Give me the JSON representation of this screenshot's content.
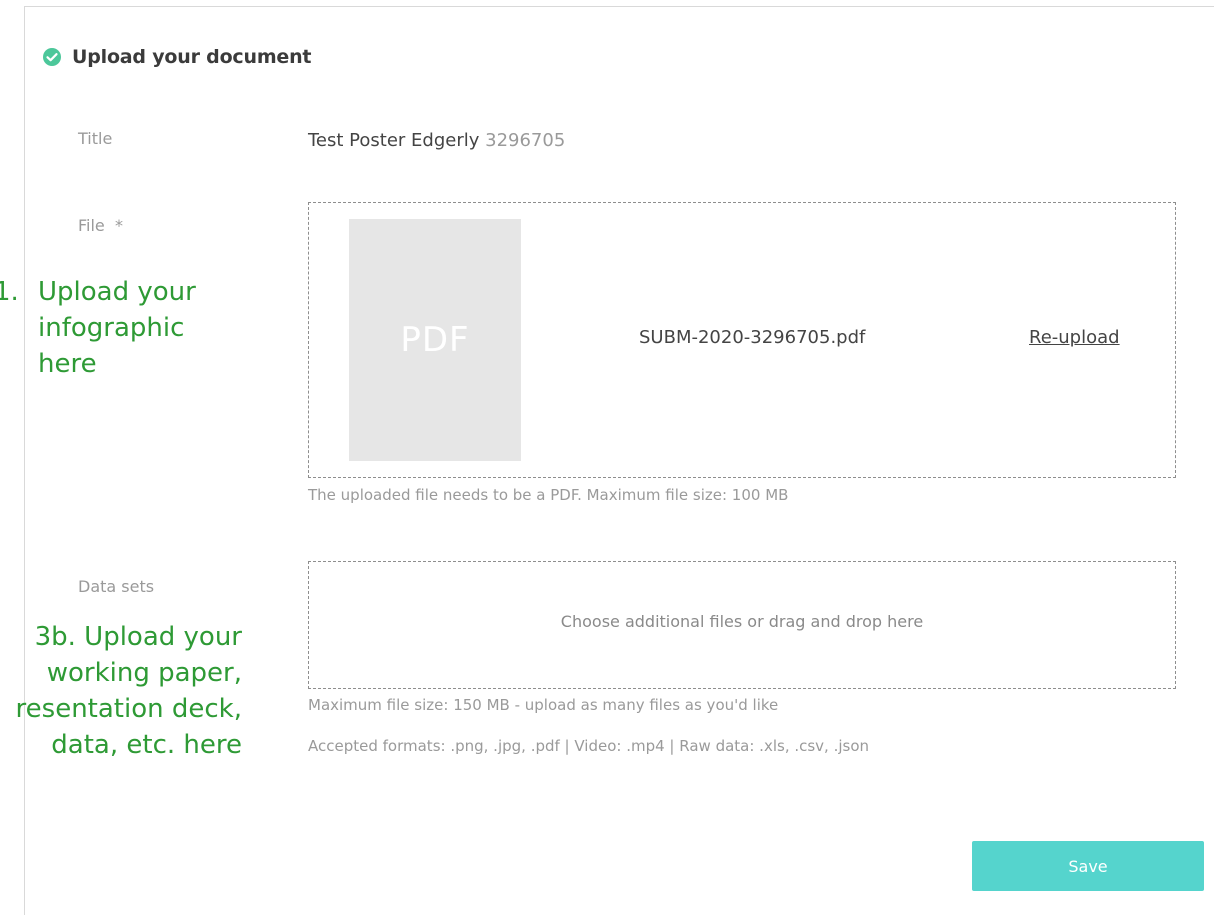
{
  "section": {
    "title": "Upload your document"
  },
  "title_field": {
    "label": "Title",
    "value": "Test Poster Edgerly",
    "id": "3296705"
  },
  "file_field": {
    "label": "File  *",
    "thumbnail_label": "PDF",
    "file_name": "SUBM-2020-3296705.pdf",
    "reupload_label": "Re-upload",
    "hint": "The uploaded file needs to be a PDF. Maximum file size: 100 MB"
  },
  "data_sets_field": {
    "label": "Data sets",
    "dropzone_text": "Choose additional files or drag and drop here",
    "hint_size": "Maximum file size: 150 MB - upload as many files as you'd like",
    "hint_formats": "Accepted formats: .png, .jpg, .pdf | Video: .mp4 | Raw data: .xls, .csv, .json"
  },
  "save_label": "Save",
  "annotations": {
    "step1_number": "1.",
    "step1_lines": [
      "Upload your",
      "infographic",
      "here"
    ],
    "step3b_lines": [
      "3b. Upload your",
      "working paper,",
      "resentation deck,",
      "data, etc. here"
    ]
  },
  "colors": {
    "accent": "#55d4cd",
    "success": "#4cc79a",
    "annotation": "#2e9a35"
  },
  "icons": {
    "section_status": "check-circle-icon"
  }
}
